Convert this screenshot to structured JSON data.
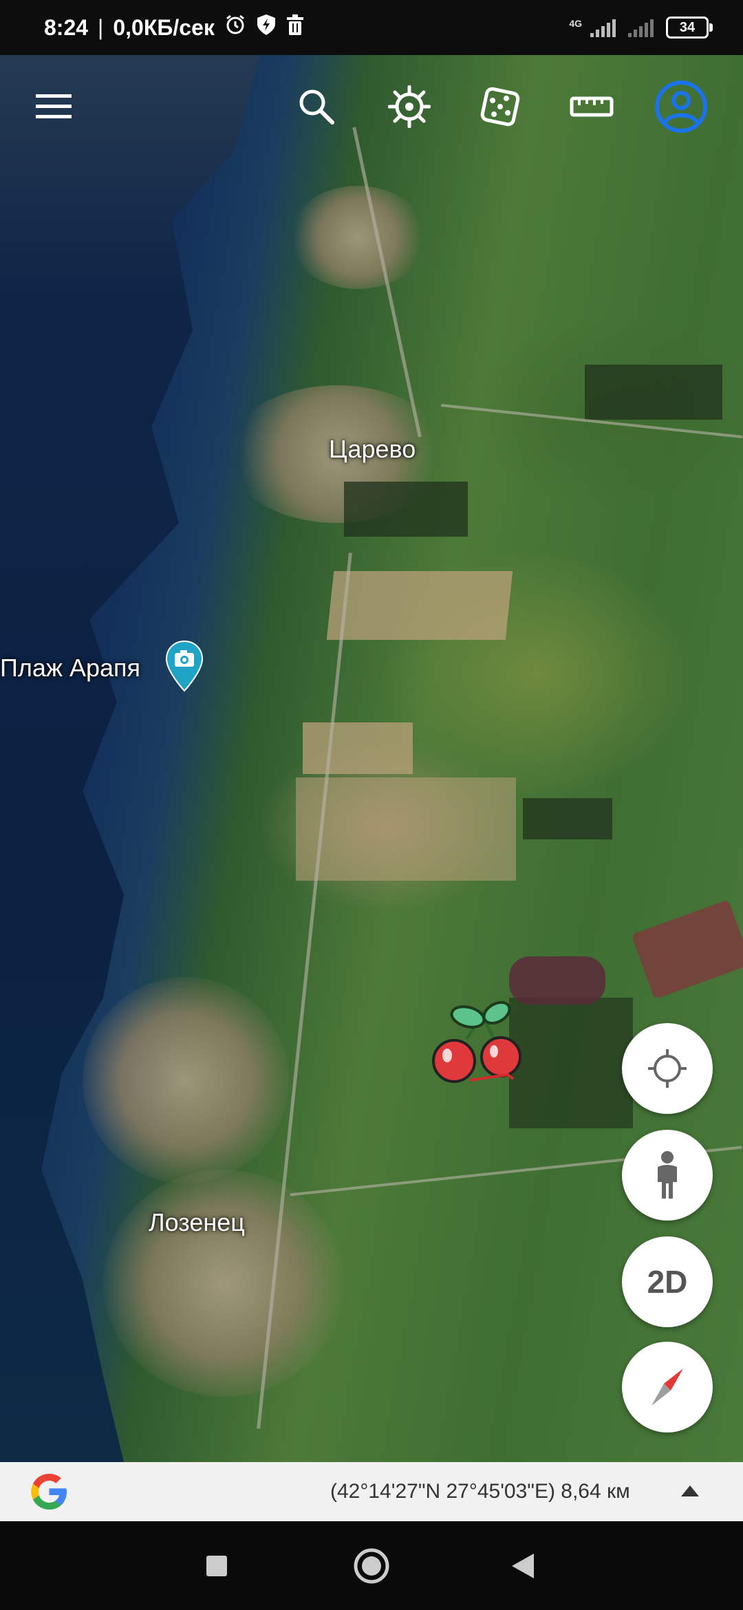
{
  "status_bar": {
    "time": "8:24",
    "separator": "|",
    "network_speed": "0,0КБ/сек",
    "network_type": "4G",
    "battery_level": "34",
    "icons": [
      "alarm-icon",
      "shield-bolt-icon",
      "trash-icon",
      "signal-icon",
      "signal-icon-2",
      "battery-icon"
    ]
  },
  "toolbar": {
    "icons": [
      "menu-icon",
      "search-icon",
      "voyager-helm-icon",
      "feeling-lucky-dice-icon",
      "measure-ruler-icon",
      "account-icon"
    ],
    "accent_color": "#1a73e8"
  },
  "map": {
    "type": "satellite",
    "places": [
      {
        "name": "Царево"
      },
      {
        "name": "Плаж Арапя"
      },
      {
        "name": "Лозенец"
      }
    ],
    "markers": [
      "photo-pin-icon",
      "cherry-icon"
    ],
    "pin_color": "#1fa4c6"
  },
  "controls": {
    "locate_icon": "my-location-icon",
    "street_view_icon": "pegman-icon",
    "view_mode_label": "2D",
    "compass_icon": "compass-icon"
  },
  "info_bar": {
    "logo": "google-g-logo",
    "coordinates": "(42°14'27\"N 27°45'03\"E) 8,64 км"
  },
  "nav_bar": {
    "icons": [
      "recent-apps-icon",
      "home-icon",
      "back-icon"
    ]
  }
}
